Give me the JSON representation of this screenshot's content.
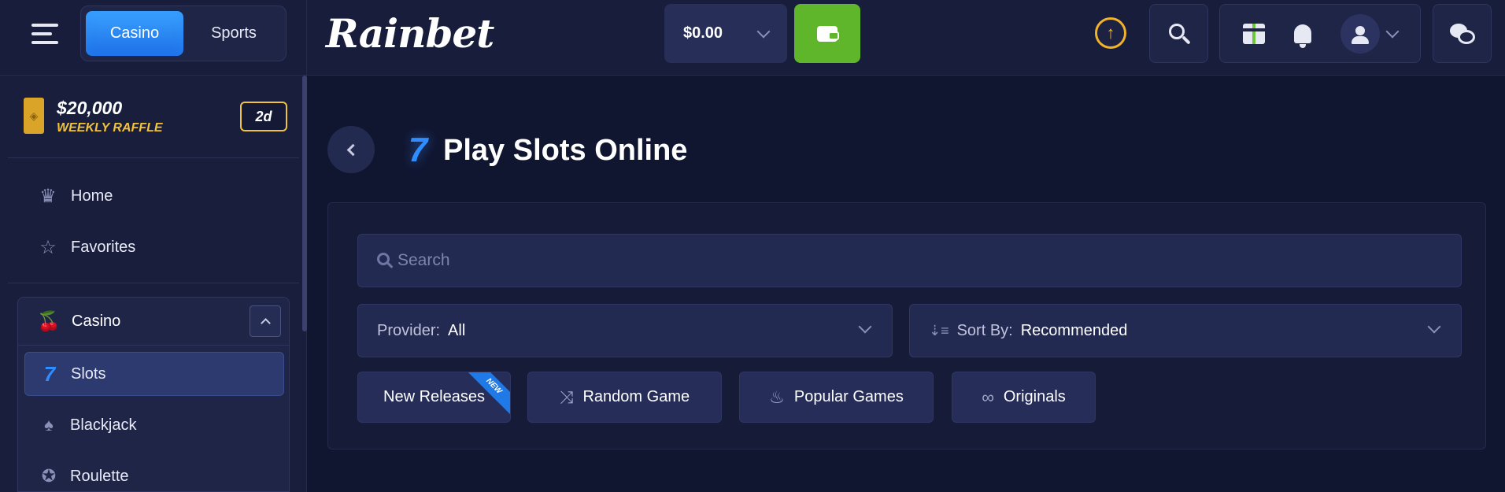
{
  "header": {
    "modes": [
      {
        "label": "Casino",
        "active": true
      },
      {
        "label": "Sports",
        "active": false
      }
    ],
    "logo": "Rainbet",
    "balance": "$0.00"
  },
  "sidebar": {
    "raffle": {
      "amount": "$20,000",
      "label": "WEEKLY RAFFLE",
      "badge": "2d"
    },
    "nav": [
      {
        "label": "Home",
        "icon": "crown-icon"
      },
      {
        "label": "Favorites",
        "icon": "star-icon"
      }
    ],
    "casino_section": {
      "label": "Casino",
      "icon": "cherries-icon",
      "expanded": true
    },
    "casino_items": [
      {
        "label": "Slots",
        "icon": "seven-icon",
        "active": true
      },
      {
        "label": "Blackjack",
        "icon": "spade-icon",
        "active": false
      },
      {
        "label": "Roulette",
        "icon": "roulette-icon",
        "active": false
      }
    ]
  },
  "main": {
    "title": "Play Slots Online",
    "search": {
      "placeholder": "Search",
      "value": ""
    },
    "provider": {
      "label": "Provider:",
      "value": "All"
    },
    "sort": {
      "label": "Sort By:",
      "value": "Recommended"
    },
    "chips": [
      {
        "label": "New Releases",
        "badge": "NEW"
      },
      {
        "label": "Random Game",
        "icon": "shuffle-icon"
      },
      {
        "label": "Popular Games",
        "icon": "flame-icon"
      },
      {
        "label": "Originals",
        "icon": "originals-icon"
      }
    ]
  },
  "colors": {
    "accent_blue": "#2f8dff",
    "wallet_green": "#5fb62a",
    "raffle_gold": "#f1c33b",
    "background": "#111630"
  }
}
